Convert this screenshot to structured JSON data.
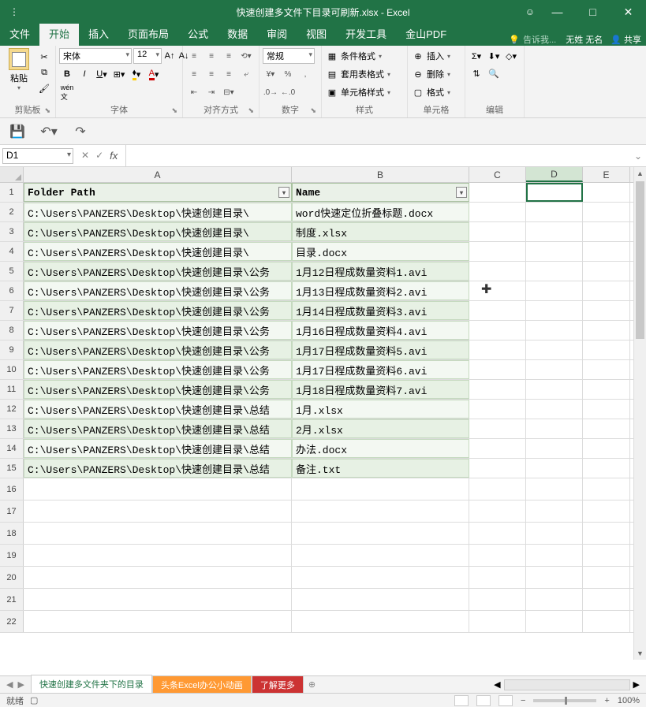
{
  "title": "快速创建多文件下目录可刷新.xlsx - Excel",
  "window_buttons": {
    "min": "—",
    "restore": "□",
    "close": "✕"
  },
  "menu": {
    "file": "文件",
    "home": "开始",
    "insert": "插入",
    "layout": "页面布局",
    "formulas": "公式",
    "data": "数据",
    "review": "审阅",
    "view": "视图",
    "dev": "开发工具",
    "wps": "金山PDF",
    "tell": "告诉我...",
    "user": "无姓 无名",
    "share": "共享"
  },
  "ribbon": {
    "clipboard": {
      "paste": "粘贴",
      "label": "剪贴板"
    },
    "font": {
      "name": "宋体",
      "size": "12",
      "label": "字体"
    },
    "align": {
      "label": "对齐方式"
    },
    "number": {
      "general": "常规",
      "label": "数字"
    },
    "styles": {
      "cond": "条件格式",
      "table": "套用表格式",
      "cell": "单元格样式",
      "label": "样式"
    },
    "cells": {
      "insert": "插入",
      "delete": "删除",
      "format": "格式",
      "label": "单元格"
    },
    "editing": {
      "label": "编辑"
    }
  },
  "name_box": "D1",
  "columns": [
    "A",
    "B",
    "C",
    "D",
    "E"
  ],
  "table": {
    "header": {
      "A": "Folder Path",
      "B": "Name"
    },
    "rows": [
      {
        "A": "C:\\Users\\PANZERS\\Desktop\\快速创建目录\\",
        "B": "word快速定位折叠标题.docx"
      },
      {
        "A": "C:\\Users\\PANZERS\\Desktop\\快速创建目录\\",
        "B": "制度.xlsx"
      },
      {
        "A": "C:\\Users\\PANZERS\\Desktop\\快速创建目录\\",
        "B": "目录.docx"
      },
      {
        "A": "C:\\Users\\PANZERS\\Desktop\\快速创建目录\\公务",
        "B": "1月12日程成数量资料1.avi"
      },
      {
        "A": "C:\\Users\\PANZERS\\Desktop\\快速创建目录\\公务",
        "B": "1月13日程成数量资料2.avi"
      },
      {
        "A": "C:\\Users\\PANZERS\\Desktop\\快速创建目录\\公务",
        "B": "1月14日程成数量资料3.avi"
      },
      {
        "A": "C:\\Users\\PANZERS\\Desktop\\快速创建目录\\公务",
        "B": "1月16日程成数量资料4.avi"
      },
      {
        "A": "C:\\Users\\PANZERS\\Desktop\\快速创建目录\\公务",
        "B": "1月17日程成数量资料5.avi"
      },
      {
        "A": "C:\\Users\\PANZERS\\Desktop\\快速创建目录\\公务",
        "B": "1月17日程成数量资料6.avi"
      },
      {
        "A": "C:\\Users\\PANZERS\\Desktop\\快速创建目录\\公务",
        "B": "1月18日程成数量资料7.avi"
      },
      {
        "A": "C:\\Users\\PANZERS\\Desktop\\快速创建目录\\总结",
        "B": "1月.xlsx"
      },
      {
        "A": "C:\\Users\\PANZERS\\Desktop\\快速创建目录\\总结",
        "B": "2月.xlsx"
      },
      {
        "A": "C:\\Users\\PANZERS\\Desktop\\快速创建目录\\总结",
        "B": "办法.docx"
      },
      {
        "A": "C:\\Users\\PANZERS\\Desktop\\快速创建目录\\总结",
        "B": "备注.txt"
      }
    ]
  },
  "sheet_tabs": {
    "tab1": "快速创建多文件夹下的目录",
    "tab2": "头条Excel办公小动画",
    "tab3": "了解更多"
  },
  "status": {
    "ready": "就绪",
    "zoom": "100%"
  }
}
